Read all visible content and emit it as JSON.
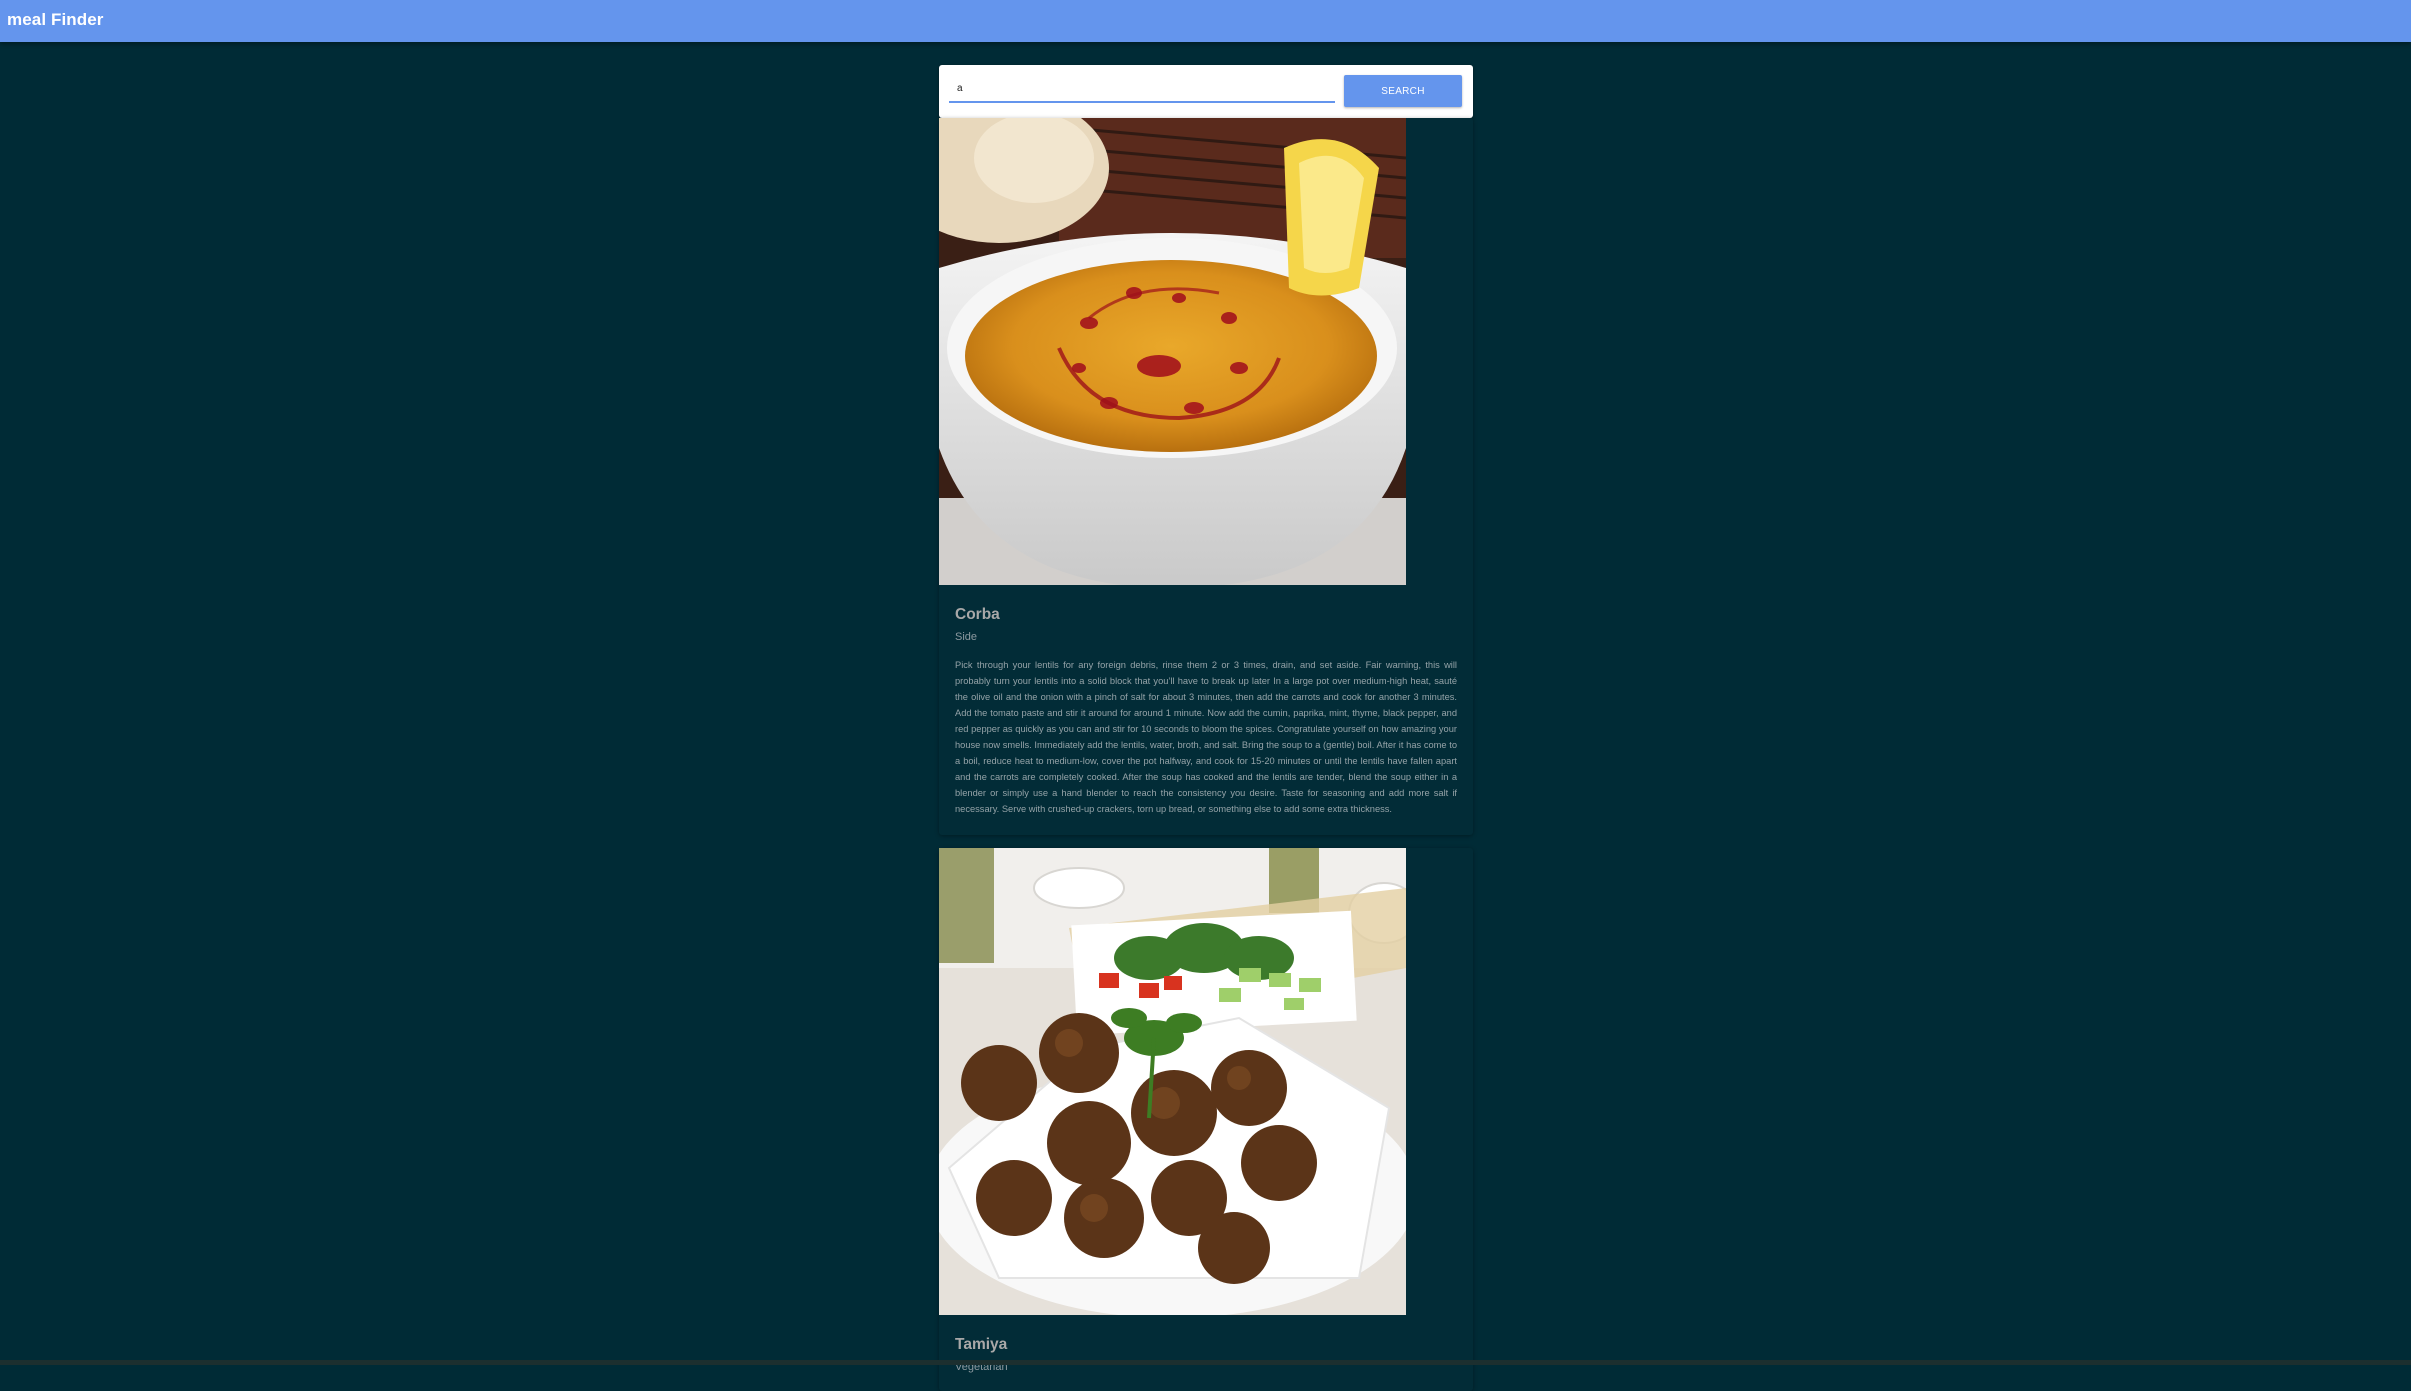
{
  "app": {
    "title": "meal Finder"
  },
  "search": {
    "value": "a",
    "button_label": "SEARCH"
  },
  "meals": [
    {
      "name": "Corba",
      "category": "Side",
      "instructions": "Pick through your lentils for any foreign debris, rinse them 2 or 3 times, drain, and set aside. Fair warning, this will probably turn your lentils into a solid block that you’ll have to break up later In a large pot over medium-high heat, sauté the olive oil and the onion with a pinch of salt for about 3 minutes, then add the carrots and cook for another 3 minutes. Add the tomato paste and stir it around for around 1 minute. Now add the cumin, paprika, mint, thyme, black pepper, and red pepper as quickly as you can and stir for 10 seconds to bloom the spices. Congratulate yourself on how amazing your house now smells. Immediately add the lentils, water, broth, and salt. Bring the soup to a (gentle) boil. After it has come to a boil, reduce heat to medium-low, cover the pot halfway, and cook for 15-20 minutes or until the lentils have fallen apart and the carrots are completely cooked. After the soup has cooked and the lentils are tender, blend the soup either in a blender or simply use a hand blender to reach the consistency you desire. Taste for seasoning and add more salt if necessary. Serve with crushed-up crackers, torn up bread, or something else to add some extra thickness."
    },
    {
      "name": "Tamiya",
      "category": "Vegetarian",
      "instructions": ""
    }
  ]
}
